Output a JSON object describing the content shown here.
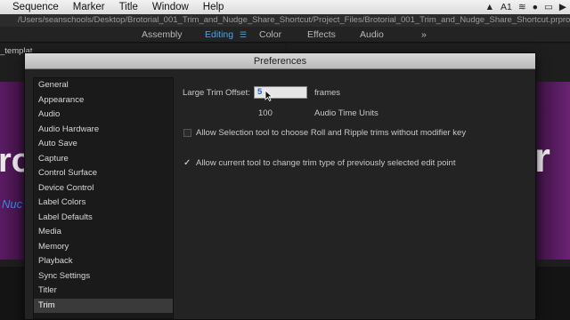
{
  "menubar": {
    "app_items": [
      "Sequence",
      "Marker",
      "Title",
      "Window",
      "Help"
    ],
    "status_icons": [
      "adobe-icon",
      "a1-badge-icon",
      "wifi-icon",
      "sync-icon",
      "display-icon",
      "volume-icon"
    ]
  },
  "path": "/Users/seanschools/Desktop/Brotorial_001_Trim_and_Nudge_Share_Shortcut/Project_Files/Brotorial_001_Trim_and_Nudge_Share_Shortcut.prproj *",
  "workspaces": {
    "tabs": [
      "Assembly",
      "Editing",
      "Color",
      "Effects",
      "Audio"
    ],
    "active": "Editing",
    "more": "»"
  },
  "background": {
    "left_tab": "_templat",
    "big_left": "ro",
    "big_right": "r",
    "sub_left": "Nuc"
  },
  "dialog": {
    "title": "Preferences",
    "categories": [
      "General",
      "Appearance",
      "Audio",
      "Audio Hardware",
      "Auto Save",
      "Capture",
      "Control Surface",
      "Device Control",
      "Label Colors",
      "Label Defaults",
      "Media",
      "Memory",
      "Playback",
      "Sync Settings",
      "Titler",
      "Trim"
    ],
    "selected_category": "Trim",
    "large_trim_offset_label": "Large Trim Offset:",
    "large_trim_offset_value": "5",
    "large_trim_offset_unit": "frames",
    "audio_trim_value": "100",
    "audio_trim_unit": "Audio Time Units",
    "option1_label": "Allow Selection tool to choose Roll and Ripple trims without modifier key",
    "option1_checked": false,
    "option2_label": "Allow current tool to change trim type of previously selected edit point",
    "option2_checked": true
  }
}
